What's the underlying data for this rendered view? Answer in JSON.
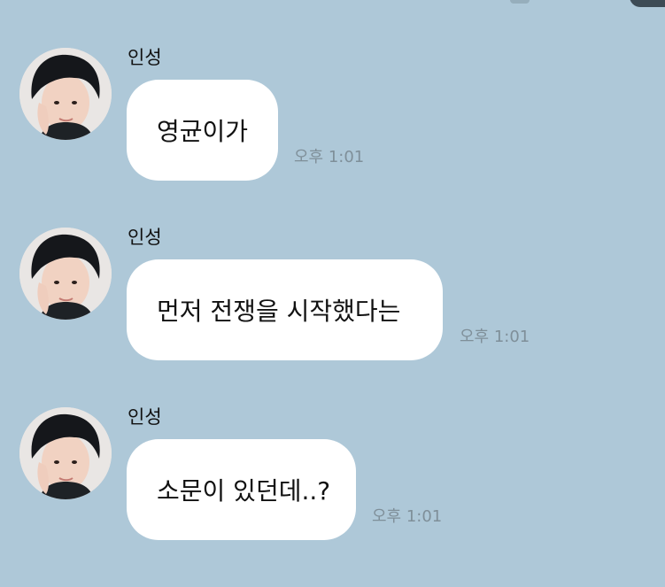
{
  "messages": [
    {
      "sender": "인성",
      "text": "영균이가",
      "time": "오후 1:01"
    },
    {
      "sender": "인성",
      "text": "먼저 전쟁을 시작했다는",
      "time": "오후 1:01"
    },
    {
      "sender": "인성",
      "text": "소문이 있던데..?",
      "time": "오후 1:01"
    }
  ],
  "colors": {
    "background": "#aec8d8",
    "bubble": "#ffffff",
    "time_text": "#7f8f99"
  }
}
